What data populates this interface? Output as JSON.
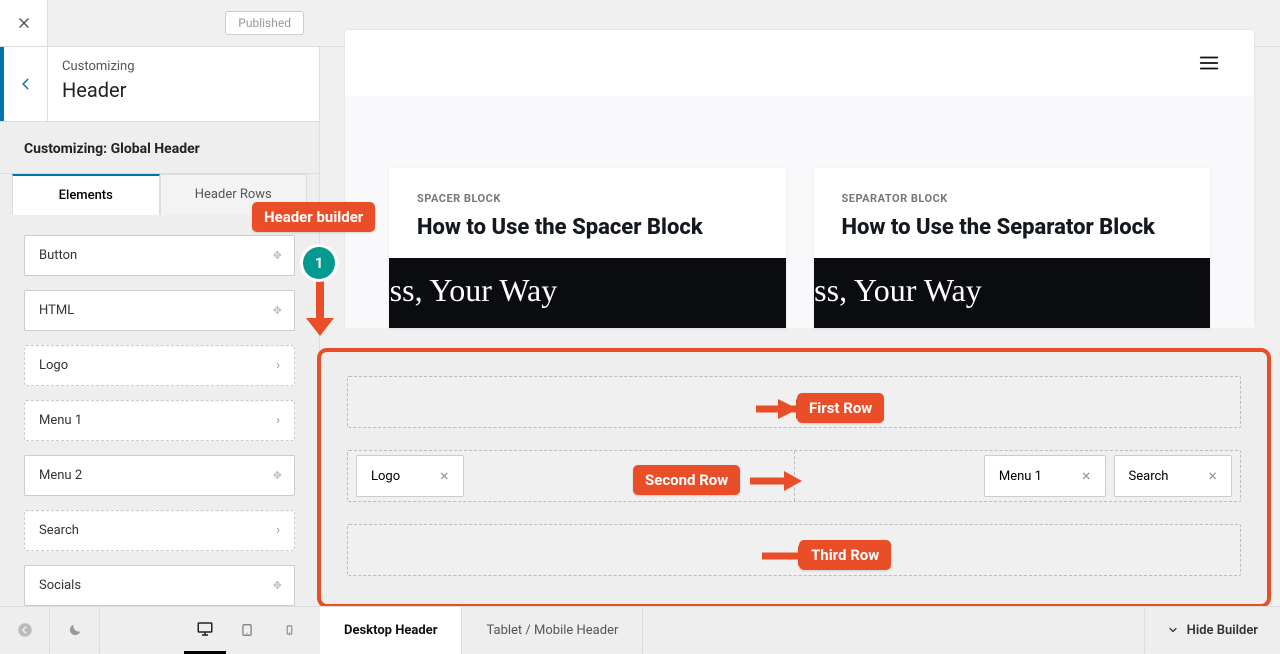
{
  "top": {
    "published": "Published"
  },
  "customizer": {
    "breadcrumb": "Customizing",
    "title": "Header",
    "subheading": "Customizing: Global Header",
    "tabs": {
      "elements": "Elements",
      "rows": "Header Rows"
    },
    "elements": {
      "button": "Button",
      "html": "HTML",
      "logo": "Logo",
      "menu1": "Menu 1",
      "menu2": "Menu 2",
      "search": "Search",
      "socials": "Socials"
    }
  },
  "preview": {
    "cards": [
      {
        "kicker": "SPACER BLOCK",
        "title": "How to Use the Spacer Block",
        "hero": "dPress, Your Way"
      },
      {
        "kicker": "SEPARATOR BLOCK",
        "title": "How to Use the Separator Block",
        "hero": "dPress, Your Way"
      }
    ]
  },
  "builder": {
    "chips": {
      "logo": "Logo",
      "menu1": "Menu 1",
      "search": "Search"
    }
  },
  "footer": {
    "desktop_tab": "Desktop Header",
    "mobile_tab": "Tablet / Mobile Header",
    "hide": "Hide Builder"
  },
  "annotations": {
    "header_builder": "Header builder",
    "step": "1",
    "first_row": "First Row",
    "second_row": "Second Row",
    "third_row": "Third Row"
  }
}
